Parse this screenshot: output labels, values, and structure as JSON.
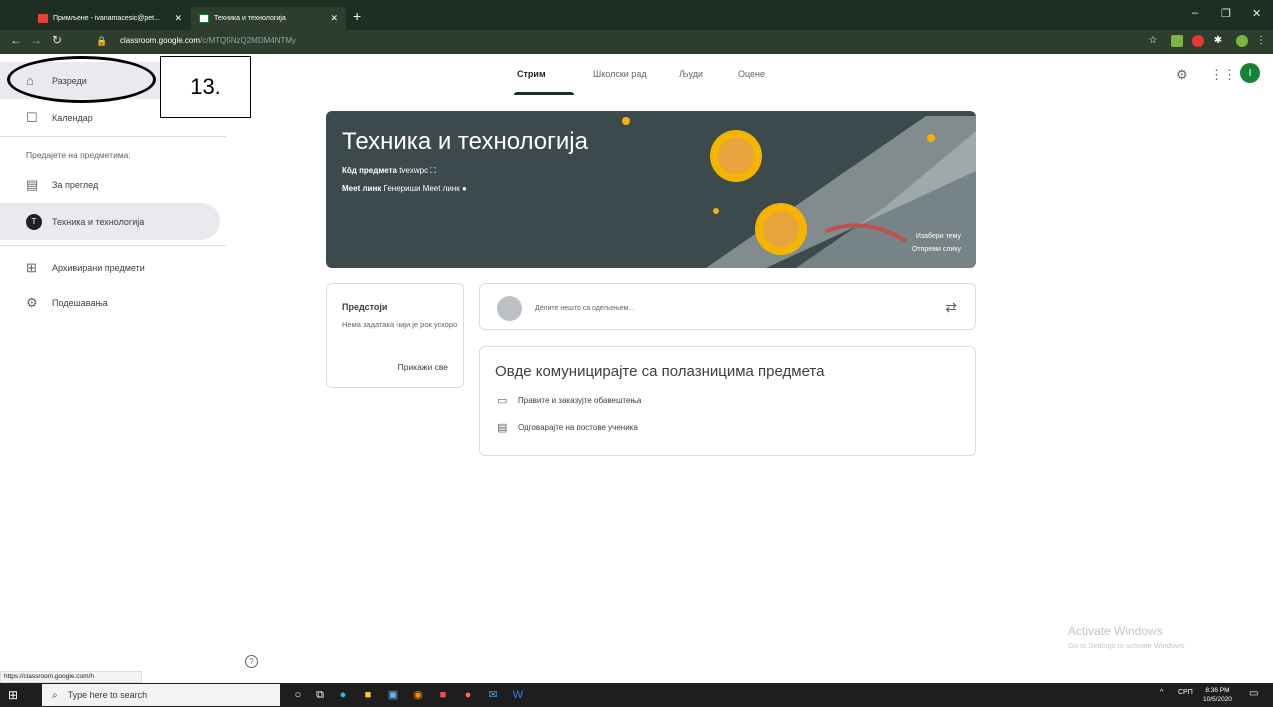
{
  "browser": {
    "tabs": [
      {
        "title": "Примљене - ivanamacesic@pet...",
        "active": false
      },
      {
        "title": "Техника и технологија",
        "active": true
      }
    ],
    "url_domain": "classroom.google.com",
    "url_path": "/c/MTQ5NzQ2MDM4NTMy",
    "new_tab": "+",
    "minimize": "–",
    "maximize": "❐",
    "close": "✕"
  },
  "sidebar": {
    "classes": "Разреди",
    "calendar": "Календар",
    "teaching_header": "Предајете на предметима:",
    "to_review": "За преглед",
    "class_item": "Техника и технологија",
    "class_initial": "T",
    "archived": "Архивирани предмети",
    "settings": "Подешавања"
  },
  "annotation": {
    "label": "13."
  },
  "topnav": {
    "tabs": [
      "Стрим",
      "Школски рад",
      "Људи",
      "Оцене"
    ],
    "active_tab": "Стрим",
    "profile_initial": "I"
  },
  "banner": {
    "title": "Техника и технологија",
    "code_label": "Кôд предмета",
    "code_value": "tvexwpc",
    "meet_label": "Meet линк",
    "meet_value": "Генериши Meet линк",
    "choose_theme": "Изабери тему",
    "upload_photo": "Отпреми слику"
  },
  "upcoming": {
    "title": "Предстоји",
    "none_text": "Нема задатака чији је рок ускоро",
    "view_all": "Прикажи све"
  },
  "share": {
    "placeholder": "Делите нешто са одељењем..."
  },
  "communicate": {
    "title": "Овде комуницирајте са полазницима предмета",
    "item1": "Правите и заказујте обавештења",
    "item2": "Одговарајте на постове ученика"
  },
  "status_bar": {
    "url": "https://classroom.google.com/h"
  },
  "watermark": {
    "line1": "Activate Windows",
    "line2": "Go to Settings to activate Windows."
  },
  "taskbar": {
    "search_placeholder": "Type here to search",
    "lang": "СРП",
    "time": "8:36 PM",
    "date": "10/5/2020"
  },
  "colors": {
    "banner_bg": "#3c4a4d",
    "chrome_dark": "#1e2e22",
    "profile_green": "#188038"
  }
}
